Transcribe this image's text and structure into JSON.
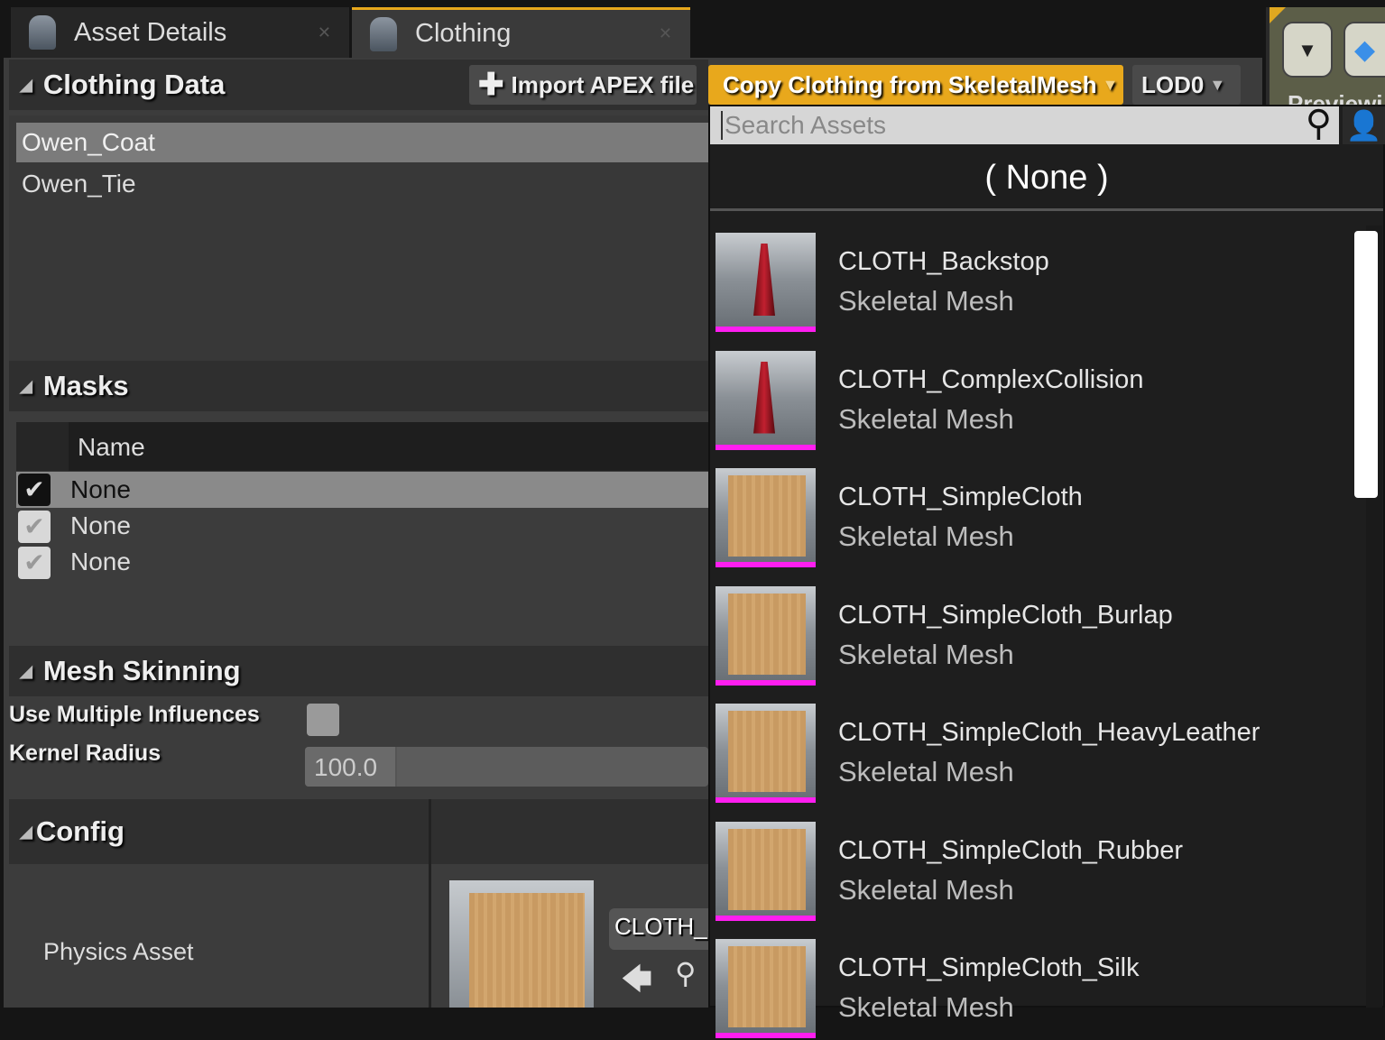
{
  "tabs": [
    {
      "label": "Asset Details",
      "active": false
    },
    {
      "label": "Clothing",
      "active": true
    }
  ],
  "toolbar": {
    "import_label": "Import APEX file",
    "copy_label": "Copy Clothing from SkeletalMesh",
    "lod_label": "LOD0",
    "accent": "#e8a81c"
  },
  "clothing_data": {
    "title": "Clothing Data",
    "items": [
      "Owen_Coat",
      "Owen_Tie"
    ],
    "selected": "Owen_Coat"
  },
  "masks": {
    "title": "Masks",
    "column": "Name",
    "rows": [
      {
        "name": "None",
        "checked": true,
        "selected": true
      },
      {
        "name": "None",
        "checked": true
      },
      {
        "name": "None",
        "checked": true
      }
    ]
  },
  "mesh_skinning": {
    "title": "Mesh Skinning",
    "use_multiple_influences_label": "Use Multiple Influences",
    "use_multiple_influences": false,
    "kernel_radius_label": "Kernel Radius",
    "kernel_radius": "100.0"
  },
  "config": {
    "title": "Config",
    "physics_asset_label": "Physics Asset",
    "physics_asset_value": "CLOTH_S"
  },
  "preview": {
    "label": "Previewi"
  },
  "picker": {
    "search_placeholder": "Search Assets",
    "none_label": "( None )",
    "assets": [
      {
        "name": "CLOTH_Backstop",
        "type": "Skeletal Mesh",
        "thumb": "cone"
      },
      {
        "name": "CLOTH_ComplexCollision",
        "type": "Skeletal Mesh",
        "thumb": "cone"
      },
      {
        "name": "CLOTH_SimpleCloth",
        "type": "Skeletal Mesh",
        "thumb": "cloth"
      },
      {
        "name": "CLOTH_SimpleCloth_Burlap",
        "type": "Skeletal Mesh",
        "thumb": "cloth"
      },
      {
        "name": "CLOTH_SimpleCloth_HeavyLeather",
        "type": "Skeletal Mesh",
        "thumb": "cloth"
      },
      {
        "name": "CLOTH_SimpleCloth_Rubber",
        "type": "Skeletal Mesh",
        "thumb": "cloth"
      },
      {
        "name": "CLOTH_SimpleCloth_Silk",
        "type": "Skeletal Mesh",
        "thumb": "cloth"
      }
    ]
  }
}
